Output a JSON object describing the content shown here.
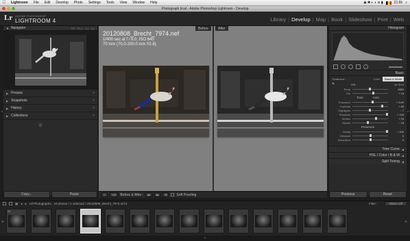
{
  "menubar": {
    "apple_glyph": "",
    "items": [
      "Lightroom",
      "File",
      "Edit",
      "Develop",
      "Photo",
      "Settings",
      "Tools",
      "View",
      "Window",
      "Help"
    ],
    "clock": "21:55"
  },
  "window": {
    "title": "Photograph.lrcat - Adobe Photoshop Lightroom - Develop"
  },
  "identity": {
    "logo_mark": "Lr",
    "brand_small": "ADOBE PHOTOSHOP",
    "product": "LIGHTROOM 4",
    "modules": [
      "Library",
      "Develop",
      "Map",
      "Book",
      "Slideshow",
      "Print",
      "Web"
    ],
    "active_module": "Develop"
  },
  "left_panel": {
    "navigator_label": "Navigator",
    "navigator_opts": [
      "FIT",
      "FILL",
      "1:1",
      "3:1"
    ],
    "sections": [
      "Presets",
      "Snapshots",
      "History",
      "Collections"
    ],
    "copy_label": "Copy...",
    "paste_label": "Paste"
  },
  "center": {
    "before_label": "Before",
    "after_label": "After",
    "filename": "20120808_Brecht_7974.nef",
    "exposure_line": "1/400 sec at f / 8.0, ISO 640",
    "lens_line": "70 mm (70.0-200.0 mm f/2.8)"
  },
  "toolbar": {
    "view_btn": "□",
    "yy_btn": "Y|Y",
    "before_after_label": "Before & After :",
    "soft_proofing_label": "Soft Proofing"
  },
  "right_panel": {
    "histogram_label": "Histogram",
    "basic_label": "Basic",
    "treatment_label": "Treatment :",
    "color_option": "Color",
    "bw_option": "Black & White",
    "wb_label": "WB :",
    "wb_value": "As Shot",
    "tone_label": "Tone",
    "tone_auto": "Auto",
    "presence_label": "Presence",
    "wb_sliders": [
      {
        "label": "Temp",
        "value": "4850"
      },
      {
        "label": "Tint",
        "value": "+ 16"
      }
    ],
    "tone_sliders": [
      {
        "label": "Exposure",
        "value": "+ 0.40"
      },
      {
        "label": "Contrast",
        "value": "+ 69"
      },
      {
        "label": "Highlights",
        "value": "− 7"
      },
      {
        "label": "Shadows",
        "value": "+ 100"
      },
      {
        "label": "Whites",
        "value": "+ 29"
      },
      {
        "label": "Blacks",
        "value": "− 18"
      }
    ],
    "presence_sliders": [
      {
        "label": "Clarity",
        "value": "+ 100"
      },
      {
        "label": "Vibrance",
        "value": "0"
      },
      {
        "label": "Saturation",
        "value": "0"
      }
    ],
    "collapsed": [
      "Tone Curve",
      "HSL / Color / B & W",
      "Split Toning"
    ],
    "previous_label": "Previous",
    "reset_label": "Reset"
  },
  "filmstrip": {
    "source_label": "All Photographs",
    "count_text": "19 photos / 1 selected / 20120808_Brecht_7974.nef ▾",
    "filter_label": "Filter :",
    "filter_value": "Filters Off",
    "first_badge": "19",
    "thumb_count": 14,
    "selected_index": 3
  },
  "colors": {
    "panel_bg": "#2a2a2a",
    "center_bg": "#808080",
    "active_text": "#eaeaea",
    "inactive_text": "#8a8a8a"
  }
}
